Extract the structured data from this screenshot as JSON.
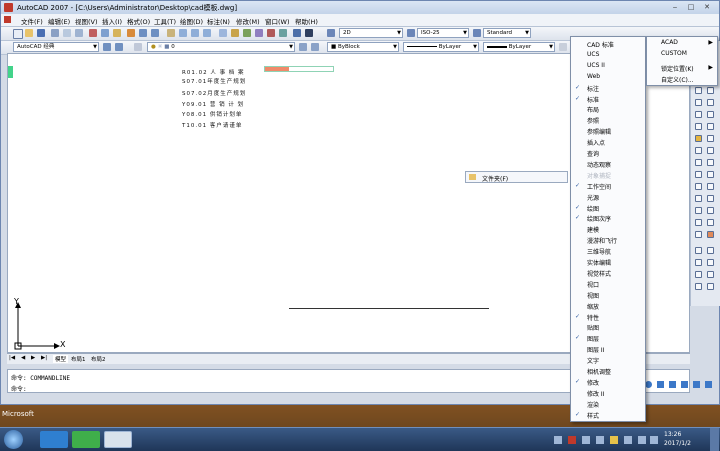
{
  "window": {
    "title": "AutoCAD 2007 - [C:\\Users\\Administrator\\Desktop\\cad模板.dwg]"
  },
  "menubar": {
    "items": [
      "文件(F)",
      "编辑(E)",
      "视图(V)",
      "插入(I)",
      "格式(O)",
      "工具(T)",
      "绘图(D)",
      "标注(N)",
      "修改(M)",
      "窗口(W)",
      "帮助(H)"
    ]
  },
  "toolbars": {
    "dim_style": "ISO-25",
    "text_style": "Standard",
    "annotation_scale": "2D",
    "workspace": "AutoCAD 经典",
    "layer": "0",
    "color": "ByBlock",
    "linetype": "ByLayer",
    "lineweight": "ByLayer"
  },
  "drawing": {
    "lines": [
      "R01.02 人 事 档 案",
      "S07.01年度生产规划",
      "S07.02月度生产规划",
      "Y09.01 营 销 计 划",
      "Y08.01 供销计划单",
      "T10.01 客户请谨单"
    ]
  },
  "ucs": {
    "x_label": "X",
    "y_label": "Y"
  },
  "layout_tabs": [
    "模型",
    "布局1",
    "布局2"
  ],
  "command": {
    "history": "命令: COMMANDLINE",
    "prompt": "命令:"
  },
  "context_menu": {
    "items": [
      {
        "label": "CAD 标准",
        "checked": false,
        "arrow": false
      },
      {
        "label": "UCS",
        "checked": false,
        "arrow": false
      },
      {
        "label": "UCS II",
        "checked": false,
        "arrow": false
      },
      {
        "label": "Web",
        "checked": false,
        "arrow": false
      },
      {
        "label": "标注",
        "checked": true,
        "arrow": false
      },
      {
        "label": "标准",
        "checked": true,
        "arrow": false
      },
      {
        "label": "布局",
        "checked": false,
        "arrow": false
      },
      {
        "label": "参照",
        "checked": false,
        "arrow": false
      },
      {
        "label": "参照编辑",
        "checked": false,
        "arrow": false
      },
      {
        "label": "插入点",
        "checked": false,
        "arrow": false
      },
      {
        "label": "查询",
        "checked": false,
        "arrow": false
      },
      {
        "label": "动态观察",
        "checked": false,
        "arrow": false
      },
      {
        "label": "对象捕捉",
        "checked": false,
        "arrow": false,
        "disabled": true
      },
      {
        "label": "工作空间",
        "checked": true,
        "arrow": false
      },
      {
        "label": "光源",
        "checked": false,
        "arrow": false
      },
      {
        "label": "绘图",
        "checked": true,
        "arrow": false
      },
      {
        "label": "绘图次序",
        "checked": true,
        "arrow": false
      },
      {
        "label": "建模",
        "checked": false,
        "arrow": false
      },
      {
        "label": "漫游和飞行",
        "checked": false,
        "arrow": false
      },
      {
        "label": "三维导航",
        "checked": false,
        "arrow": false
      },
      {
        "label": "实体编辑",
        "checked": false,
        "arrow": false
      },
      {
        "label": "视觉样式",
        "checked": false,
        "arrow": false
      },
      {
        "label": "视口",
        "checked": false,
        "arrow": false
      },
      {
        "label": "视图",
        "checked": false,
        "arrow": false
      },
      {
        "label": "缩放",
        "checked": false,
        "arrow": false
      },
      {
        "label": "特性",
        "checked": true,
        "arrow": false
      },
      {
        "label": "贴图",
        "checked": false,
        "arrow": false
      },
      {
        "label": "图层",
        "checked": true,
        "arrow": false
      },
      {
        "label": "图层 II",
        "checked": false,
        "arrow": false
      },
      {
        "label": "文字",
        "checked": false,
        "arrow": false
      },
      {
        "label": "相机调整",
        "checked": false,
        "arrow": false
      },
      {
        "label": "修改",
        "checked": true,
        "arrow": false
      },
      {
        "label": "修改 II",
        "checked": false,
        "arrow": false
      },
      {
        "label": "渲染",
        "checked": false,
        "arrow": false
      },
      {
        "label": "样式",
        "checked": true,
        "arrow": false
      }
    ]
  },
  "submenu": {
    "items": [
      {
        "label": "ACAD",
        "arrow": true
      },
      {
        "label": "CUSTOM",
        "arrow": false
      },
      {
        "label": "锁定位置(K)",
        "arrow": true
      },
      {
        "label": "自定义(C)...",
        "arrow": false
      }
    ]
  },
  "folder_popup": {
    "label": "文件夹(F)"
  },
  "desktop": {
    "label": "Microsoft"
  },
  "clock": {
    "time": "13:26",
    "date": "2017/1/2"
  }
}
